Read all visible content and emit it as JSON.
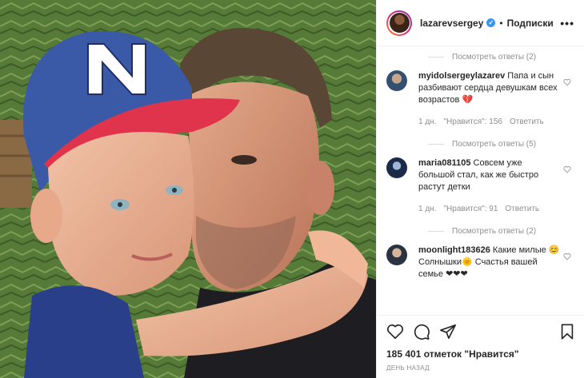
{
  "header": {
    "username": "lazarevsergey",
    "follow_label": "Подписки",
    "separator": "•",
    "more_label": "•••"
  },
  "comments": [
    {
      "type": "replies",
      "label": "Посмотреть ответы (2)"
    },
    {
      "type": "comment",
      "user": "myidolsergeylazarev",
      "text": "Папа и сын разбивают сердца девушкам всех возрастов",
      "emoji": "💔",
      "time": "1 дн.",
      "likes": "\"Нравится\": 156",
      "reply": "Ответить"
    },
    {
      "type": "replies",
      "label": "Посмотреть ответы (5)"
    },
    {
      "type": "comment",
      "user": "maria081105",
      "text": "Совсем уже большой стал, как же быстро растут детки",
      "emoji": "",
      "time": "1 дн.",
      "likes": "\"Нравится\": 91",
      "reply": "Ответить"
    },
    {
      "type": "replies",
      "label": "Посмотреть ответы (2)"
    },
    {
      "type": "comment",
      "user": "moonlight183626",
      "text": "Какие милые 😊 Солнышки🌞 Счастья вашей семье ❤❤❤",
      "emoji": "",
      "time": "",
      "likes": "",
      "reply": ""
    }
  ],
  "likes_count": "185 401 отметок \"Нравится\"",
  "date": "День назад",
  "colors": {
    "verified": "#3897f0",
    "muted": "#8e8e8e",
    "text": "#262626",
    "border": "#efefef"
  }
}
